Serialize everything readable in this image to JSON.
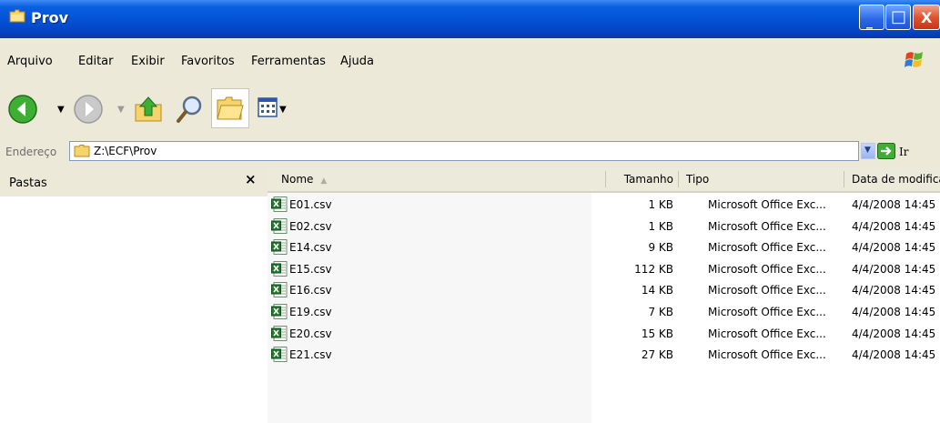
{
  "window": {
    "title": "Prov",
    "min_glyph": "_",
    "max_glyph": "□",
    "close_glyph": "X"
  },
  "menu": {
    "items": [
      "Arquivo",
      "Editar",
      "Exibir",
      "Favoritos",
      "Ferramentas",
      "Ajuda"
    ]
  },
  "toolbar": {
    "buttons": [
      "back-icon",
      "forward-icon",
      "up-folder-icon",
      "search-icon",
      "folders-icon",
      "views-icon"
    ]
  },
  "address": {
    "label": "Endereço",
    "path": "Z:\\ECF\\Prov",
    "go_label": "Ir"
  },
  "folders_pane": {
    "label": "Pastas",
    "close": "×"
  },
  "list": {
    "columns": [
      "Nome",
      "Tamanho",
      "Tipo",
      "Data de modificação"
    ],
    "sort_indicator": "▲",
    "files": [
      {
        "name": "E01.csv",
        "size": "1 KB",
        "type": "Microsoft Office Exc...",
        "date": "4/4/2008 14:45"
      },
      {
        "name": "E02.csv",
        "size": "1 KB",
        "type": "Microsoft Office Exc...",
        "date": "4/4/2008 14:45"
      },
      {
        "name": "E14.csv",
        "size": "9 KB",
        "type": "Microsoft Office Exc...",
        "date": "4/4/2008 14:45"
      },
      {
        "name": "E15.csv",
        "size": "112 KB",
        "type": "Microsoft Office Exc...",
        "date": "4/4/2008 14:45"
      },
      {
        "name": "E16.csv",
        "size": "14 KB",
        "type": "Microsoft Office Exc...",
        "date": "4/4/2008 14:45"
      },
      {
        "name": "E19.csv",
        "size": "7 KB",
        "type": "Microsoft Office Exc...",
        "date": "4/4/2008 14:45"
      },
      {
        "name": "E20.csv",
        "size": "15 KB",
        "type": "Microsoft Office Exc...",
        "date": "4/4/2008 14:45"
      },
      {
        "name": "E21.csv",
        "size": "27 KB",
        "type": "Microsoft Office Exc...",
        "date": "4/4/2008 14:45"
      }
    ]
  },
  "colors": {
    "titlebar": "#0453d6",
    "chrome": "#ece9d8",
    "close_button": "#e0542e",
    "excel_green": "#1f7a2e"
  }
}
